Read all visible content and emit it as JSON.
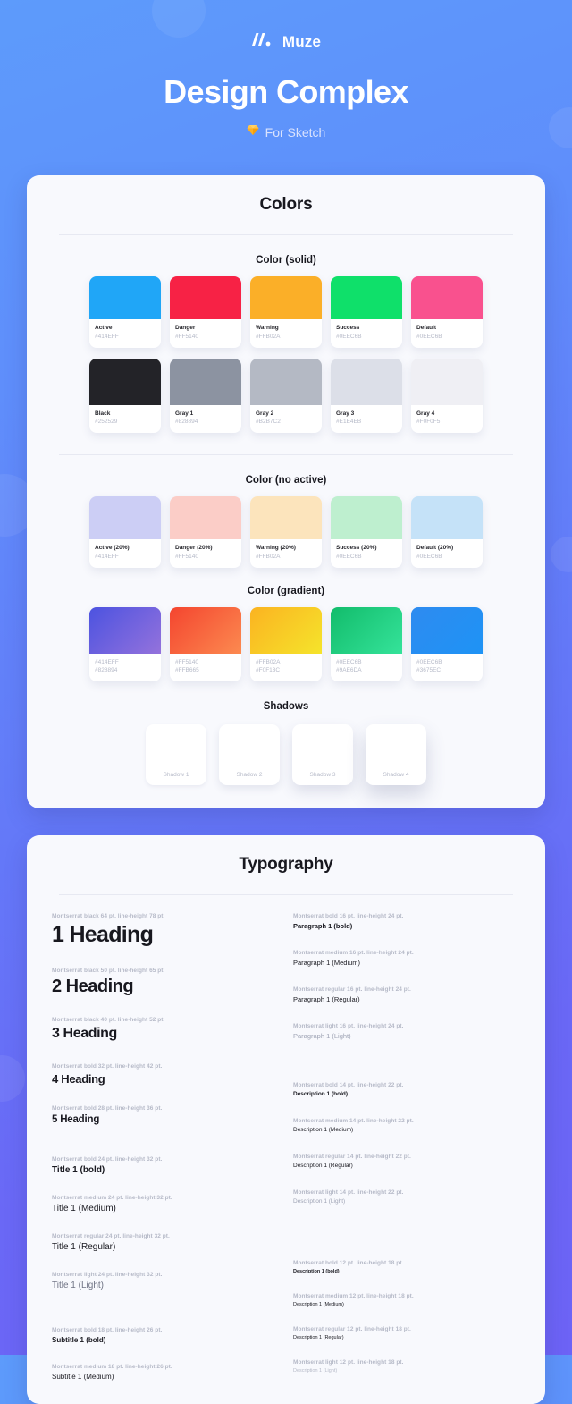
{
  "brand": {
    "name": "Muze",
    "mark_icon": "muze-logo-icon"
  },
  "hero": {
    "title": "Design Complex",
    "subtitle": "For Sketch",
    "subtitle_icon": "sketch-diamond-icon"
  },
  "colors_card": {
    "title": "Colors",
    "sections": {
      "solid": {
        "label": "Color (solid)"
      },
      "no_active": {
        "label": "Color (no active)"
      },
      "gradient": {
        "label": "Color (gradient)"
      },
      "shadows": {
        "label": "Shadows"
      }
    },
    "solid_row_1": [
      {
        "name": "Active",
        "hex": "#414EFF",
        "chip": "#20A6F7"
      },
      {
        "name": "Danger",
        "hex": "#FF5140",
        "chip": "#F72245"
      },
      {
        "name": "Warning",
        "hex": "#FFB02A",
        "chip": "#FBAF28"
      },
      {
        "name": "Success",
        "hex": "#0EEC6B",
        "chip": "#0FE06A"
      },
      {
        "name": "Default",
        "hex": "#0EEC6B",
        "chip": "#F9518E"
      }
    ],
    "solid_row_2": [
      {
        "name": "Black",
        "hex": "#252529",
        "chip": "#232328"
      },
      {
        "name": "Gray 1",
        "hex": "#828894",
        "chip": "#8C93A1"
      },
      {
        "name": "Gray 2",
        "hex": "#B2B7C2",
        "chip": "#B4B9C4"
      },
      {
        "name": "Gray 3",
        "hex": "#E1E4EB",
        "chip": "#DCDFE8"
      },
      {
        "name": "Gray 4",
        "hex": "#F0F0F5",
        "chip": "#EFEFF4"
      }
    ],
    "no_active_row": [
      {
        "name": "Active (20%)",
        "hex": "#414EFF",
        "chip": "#CCCEF5"
      },
      {
        "name": "Danger (20%)",
        "hex": "#FF5140",
        "chip": "#FBCDC7"
      },
      {
        "name": "Warning (20%)",
        "hex": "#FFB02A",
        "chip": "#FCE4BC"
      },
      {
        "name": "Success (20%)",
        "hex": "#0EEC6B",
        "chip": "#BEEFCF"
      },
      {
        "name": "Default (20%)",
        "hex": "#0EEC6B",
        "chip": "#C5E2F8"
      }
    ],
    "gradient_row": [
      {
        "hex_from": "#414EFF",
        "hex_to": "#828894",
        "chip_from": "#4C53E0",
        "chip_to": "#9472DC"
      },
      {
        "hex_from": "#FF5140",
        "hex_to": "#FFB665",
        "chip_from": "#F4452F",
        "chip_to": "#FC8A50"
      },
      {
        "hex_from": "#FFB02A",
        "hex_to": "#F0F13C",
        "chip_from": "#FBB321",
        "chip_to": "#F5E42B"
      },
      {
        "hex_from": "#0EEC6B",
        "hex_to": "#9AE6DA",
        "chip_from": "#12BC6B",
        "chip_to": "#35E39A"
      },
      {
        "hex_from": "#0EEC6B",
        "hex_to": "#3675EC",
        "chip_from": "#2E8BF0",
        "chip_to": "#1E93F5"
      }
    ],
    "shadows": [
      {
        "label": "Shadow 1"
      },
      {
        "label": "Shadow 2"
      },
      {
        "label": "Shadow 3"
      },
      {
        "label": "Shadow 4"
      }
    ]
  },
  "typography_card": {
    "title": "Typography",
    "left_column": [
      {
        "spec": "Montserrat black 64 pt. line-height 78 pt.",
        "sample": "1 Heading",
        "style": "sample-h1",
        "gap": 0
      },
      {
        "spec": "Montserrat black 50 pt. line-height 65 pt.",
        "sample": "2 Heading",
        "style": "sample-h2",
        "gap": 22
      },
      {
        "spec": "Montserrat black 40 pt. line-height 52 pt.",
        "sample": "3 Heading",
        "style": "sample-h3",
        "gap": 22
      },
      {
        "spec": "Montserrat bold 32 pt. line-height 42 pt.",
        "sample": "4 Heading",
        "style": "sample-h4",
        "gap": 24
      },
      {
        "spec": "Montserrat bold 28 pt. line-height 36 pt.",
        "sample": "5 Heading",
        "style": "sample-h5",
        "gap": 22
      },
      {
        "spec": "Montserrat bold 24 pt. line-height 32 pt.",
        "sample": "Title 1 (bold)",
        "style": "sample-t-b",
        "gap": 35
      },
      {
        "spec": "Montserrat medium 24 pt. line-height 32 pt.",
        "sample": "Title 1 (Medium)",
        "style": "sample-t-m",
        "gap": 22
      },
      {
        "spec": "Montserrat regular 24 pt. line-height 32 pt.",
        "sample": "Title 1 (Regular)",
        "style": "sample-t-r",
        "gap": 22
      },
      {
        "spec": "Montserrat light 24 pt. line-height 32 pt.",
        "sample": "Title 1 (Light)",
        "style": "sample-t-l",
        "gap": 22
      },
      {
        "spec": "Montserrat bold 18 pt. line-height 26 pt.",
        "sample": "Subtitle 1 (bold)",
        "style": "sample-s-b",
        "gap": 41
      },
      {
        "spec": "Montserrat medium 18 pt. line-height 26 pt.",
        "sample": "Subtitle 1 (Medium)",
        "style": "sample-s-m",
        "gap": 22
      }
    ],
    "right_column": [
      {
        "spec": "Montserrat bold 16 pt. line-height 24 pt.",
        "sample": "Paragraph 1 (bold)",
        "style": "sample-p-b",
        "gap": 0
      },
      {
        "spec": "Montserrat medium 16 pt. line-height 24 pt.",
        "sample": "Paragraph 1 (Medium)",
        "style": "sample-p-m",
        "gap": 22
      },
      {
        "spec": "Montserrat regular 16 pt. line-height 24 pt.",
        "sample": "Paragraph 1 (Regular)",
        "style": "sample-p-r",
        "gap": 22
      },
      {
        "spec": "Montserrat light 16 pt. line-height 24 pt.",
        "sample": "Paragraph 1 (Light)",
        "style": "sample-p-l",
        "gap": 22
      },
      {
        "spec": "Montserrat bold 14 pt. line-height 22 pt.",
        "sample": "Description 1 (bold)",
        "style": "sample-d-b",
        "gap": 47
      },
      {
        "spec": "Montserrat medium 14 pt. line-height 22 pt.",
        "sample": "Description 1 (Medium)",
        "style": "sample-d-m",
        "gap": 23
      },
      {
        "spec": "Montserrat regular 14 pt. line-height 22 pt.",
        "sample": "Description 1 (Regular)",
        "style": "sample-d-r",
        "gap": 23
      },
      {
        "spec": "Montserrat light 14 pt. line-height 22 pt.",
        "sample": "Description 1 (Light)",
        "style": "sample-d-l",
        "gap": 23
      },
      {
        "spec": "Montserrat bold 12 pt. line-height 18 pt.",
        "sample": "Description 1 (bold)",
        "style": "sample-x-b",
        "gap": 62
      },
      {
        "spec": "Montserrat medium 12 pt. line-height 18 pt.",
        "sample": "Description 1 (Medium)",
        "style": "sample-x-m",
        "gap": 21
      },
      {
        "spec": "Montserrat regular 12 pt. line-height 18 pt.",
        "sample": "Description 1 (Regular)",
        "style": "sample-x-r",
        "gap": 21
      },
      {
        "spec": "Montserrat light 12 pt. line-height 18 pt.",
        "sample": "Description 1 (Light)",
        "style": "sample-x-l",
        "gap": 21
      }
    ]
  }
}
